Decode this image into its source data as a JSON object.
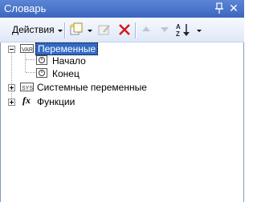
{
  "window": {
    "title": "Словарь",
    "close_glyph": "✕"
  },
  "toolbar": {
    "actions_label": "Действия"
  },
  "tree": {
    "variables": {
      "label": "Переменные",
      "icon_text": "VAR"
    },
    "start": {
      "label": "Начало"
    },
    "end": {
      "label": "Конец"
    },
    "system_variables": {
      "label": "Системные переменные",
      "icon_text": "SYS"
    },
    "functions": {
      "label": "Функции",
      "icon_text": "fx"
    }
  },
  "colors": {
    "title_bar": "#3c66c0",
    "selection": "#316ac5",
    "toolbar": "#dfe8f7"
  },
  "icons": [
    "pin-icon",
    "close-icon",
    "chevron-down-icon",
    "new-item-icon",
    "edit-icon",
    "delete-icon",
    "move-up-icon",
    "move-down-icon",
    "sort-az-icon"
  ]
}
